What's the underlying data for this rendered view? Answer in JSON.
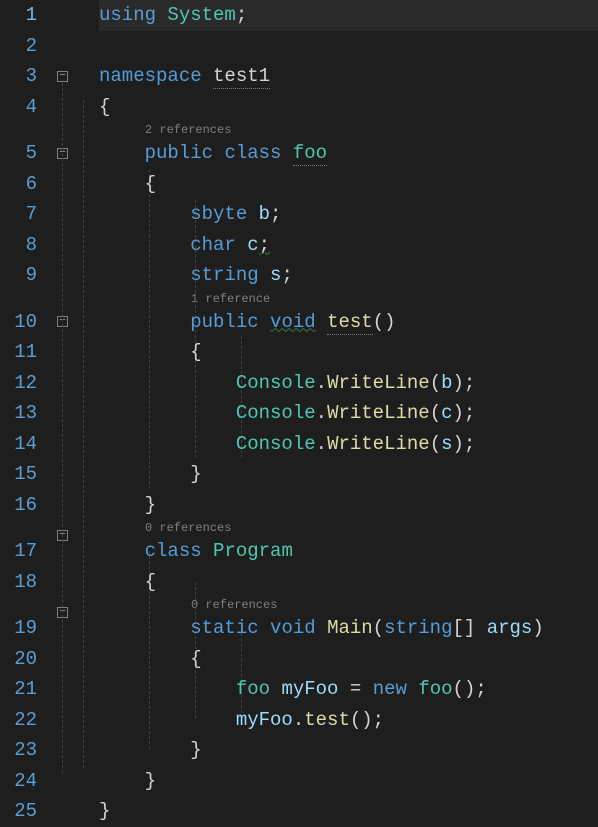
{
  "lineNumbers": [
    "1",
    "2",
    "3",
    "4",
    "5",
    "6",
    "7",
    "8",
    "9",
    "10",
    "11",
    "12",
    "13",
    "14",
    "15",
    "16",
    "17",
    "18",
    "19",
    "20",
    "21",
    "22",
    "23",
    "24",
    "25"
  ],
  "codelens": {
    "foo": "2 references",
    "test": "1 reference",
    "program": "0 references",
    "main": "0 references"
  },
  "tokens": {
    "using": "using",
    "system": "System",
    "semicolon": ";",
    "namespace": "namespace",
    "nsName": "test1",
    "lbrace": "{",
    "rbrace": "}",
    "public": "public",
    "class": "class",
    "fooType": "foo",
    "sbyte": "sbyte",
    "b": "b",
    "char": "char",
    "c": "c",
    "string": "string",
    "s": "s",
    "void": "void",
    "testMethod": "test",
    "lparen": "(",
    "rparen": ")",
    "console": "Console",
    "dot": ".",
    "writeLine": "WriteLine",
    "programType": "Program",
    "static": "static",
    "mainMethod": "Main",
    "bracketPair": "[]",
    "args": "args",
    "myFoo": "myFoo",
    "eq": "=",
    "new": "new"
  }
}
